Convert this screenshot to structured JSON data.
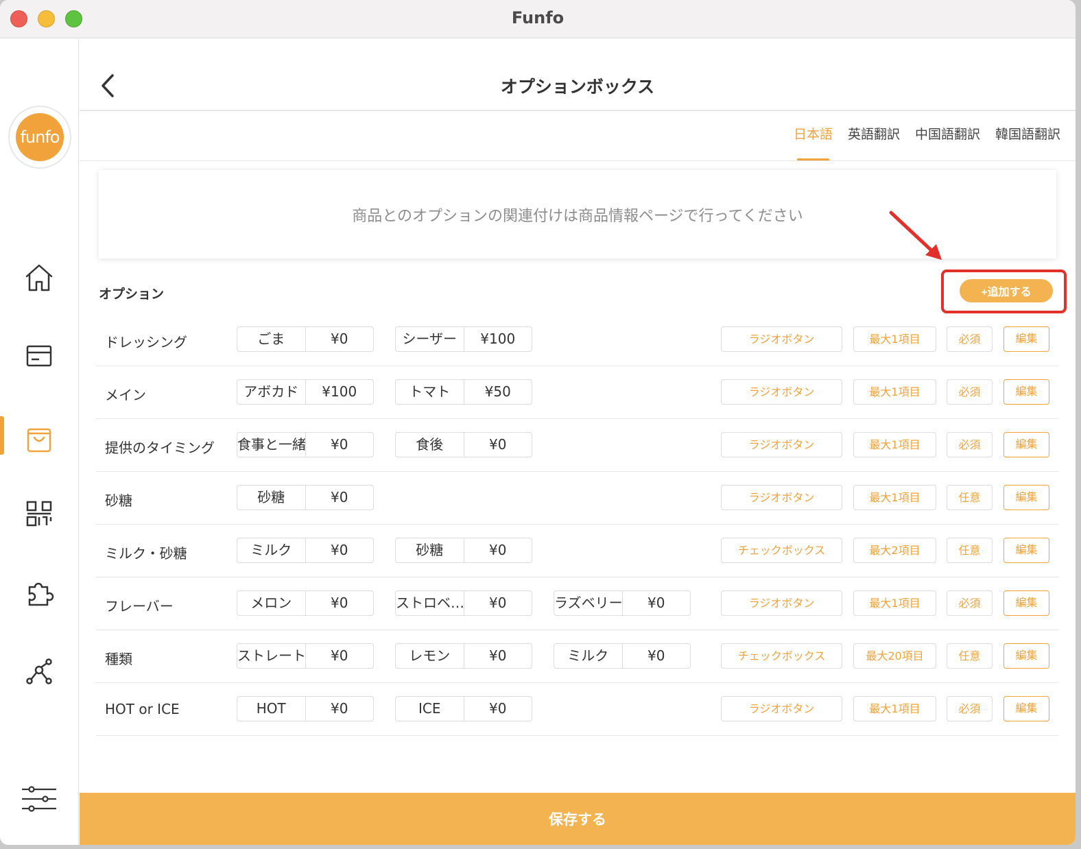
{
  "window": {
    "title": "Funfo"
  },
  "logo": {
    "text": "funfo"
  },
  "sidebar": {
    "accent_color": "#f2a23a",
    "items": [
      {
        "icon": "home-icon",
        "active": false
      },
      {
        "icon": "card-icon",
        "active": false
      },
      {
        "icon": "shopping-bag-icon",
        "active": true
      },
      {
        "icon": "qr-code-icon",
        "active": false
      },
      {
        "icon": "puzzle-icon",
        "active": false
      },
      {
        "icon": "network-icon",
        "active": false
      },
      {
        "icon": "sliders-icon",
        "active": false
      }
    ]
  },
  "header": {
    "title": "オプションボックス"
  },
  "tabs": [
    {
      "label": "日本語",
      "active": true
    },
    {
      "label": "英語翻訳",
      "active": false
    },
    {
      "label": "中国語翻訳",
      "active": false
    },
    {
      "label": "韓国語翻訳",
      "active": false
    }
  ],
  "notice": "商品とのオプションの関連付けは商品情報ページで行ってください",
  "options_section": {
    "label": "オプション",
    "add_label": "+追加する"
  },
  "rows": [
    {
      "name": "ドレッシング",
      "choices": [
        {
          "name": "ごま",
          "price": "¥0"
        },
        {
          "name": "シーザー",
          "price": "¥100"
        }
      ],
      "type": "ラジオボタン",
      "max": "最大1項目",
      "required": "必須",
      "edit": "編集"
    },
    {
      "name": "メイン",
      "choices": [
        {
          "name": "アボカド",
          "price": "¥100"
        },
        {
          "name": "トマト",
          "price": "¥50"
        }
      ],
      "type": "ラジオボタン",
      "max": "最大1項目",
      "required": "必須",
      "edit": "編集"
    },
    {
      "name": "提供のタイミング",
      "choices": [
        {
          "name": "食事と一緒",
          "price": "¥0"
        },
        {
          "name": "食後",
          "price": "¥0"
        }
      ],
      "type": "ラジオボタン",
      "max": "最大1項目",
      "required": "必須",
      "edit": "編集"
    },
    {
      "name": "砂糖",
      "choices": [
        {
          "name": "砂糖",
          "price": "¥0"
        }
      ],
      "type": "ラジオボタン",
      "max": "最大1項目",
      "required": "任意",
      "edit": "編集"
    },
    {
      "name": "ミルク・砂糖",
      "choices": [
        {
          "name": "ミルク",
          "price": "¥0"
        },
        {
          "name": "砂糖",
          "price": "¥0"
        }
      ],
      "type": "チェックボックス",
      "max": "最大2項目",
      "required": "任意",
      "edit": "編集"
    },
    {
      "name": "フレーバー",
      "choices": [
        {
          "name": "メロン",
          "price": "¥0"
        },
        {
          "name": "ストロベ…",
          "price": "¥0"
        },
        {
          "name": "ラズベリー",
          "price": "¥0"
        }
      ],
      "type": "ラジオボタン",
      "max": "最大1項目",
      "required": "必須",
      "edit": "編集"
    },
    {
      "name": "種類",
      "choices": [
        {
          "name": "ストレート",
          "price": "¥0"
        },
        {
          "name": "レモン",
          "price": "¥0"
        },
        {
          "name": "ミルク",
          "price": "¥0"
        }
      ],
      "type": "チェックボックス",
      "max": "最大20項目",
      "required": "任意",
      "edit": "編集"
    },
    {
      "name": "HOT or ICE",
      "choices": [
        {
          "name": "HOT",
          "price": "¥0"
        },
        {
          "name": "ICE",
          "price": "¥0"
        }
      ],
      "type": "ラジオボタン",
      "max": "最大1項目",
      "required": "必須",
      "edit": "編集"
    }
  ],
  "save_label": "保存する",
  "annotation": {
    "color": "#e2302a"
  }
}
